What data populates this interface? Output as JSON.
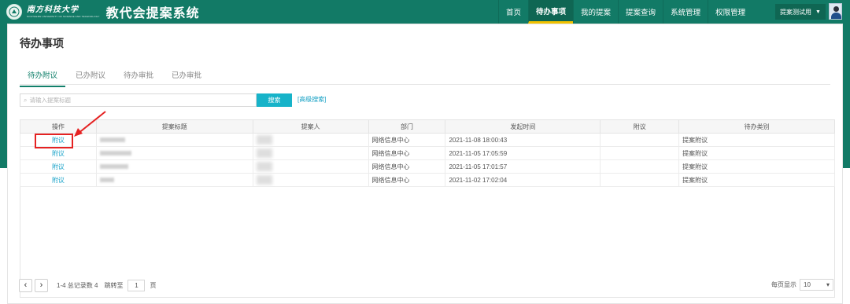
{
  "header": {
    "university_name": "南方科技大学",
    "university_en": "SOUTHERN UNIVERSITY OF SCIENCE AND TECHNOLOGY",
    "system_title": "教代会提案系统",
    "nav": [
      {
        "label": "首页",
        "active": false
      },
      {
        "label": "待办事项",
        "active": true
      },
      {
        "label": "我的提案",
        "active": false
      },
      {
        "label": "提案查询",
        "active": false
      },
      {
        "label": "系统管理",
        "active": false
      },
      {
        "label": "权限管理",
        "active": false
      }
    ],
    "user_label": "提案测试用"
  },
  "page": {
    "title": "待办事项",
    "tabs": [
      {
        "label": "待办附议",
        "active": true
      },
      {
        "label": "已办附议",
        "active": false
      },
      {
        "label": "待办审批",
        "active": false
      },
      {
        "label": "已办审批",
        "active": false
      }
    ]
  },
  "search": {
    "placeholder": "请输入提案标题",
    "button": "搜索",
    "advanced": "[高级搜索]"
  },
  "table": {
    "columns": [
      "操作",
      "提案标题",
      "提案人",
      "部门",
      "发起时间",
      "附议",
      "待办类别"
    ],
    "rows": [
      {
        "op": "附议",
        "dept": "网络信息中心",
        "time": "2021-11-08 18:00:43",
        "category": "提案附议"
      },
      {
        "op": "附议",
        "dept": "网络信息中心",
        "time": "2021-11-05 17:05:59",
        "category": "提案附议"
      },
      {
        "op": "附议",
        "dept": "网络信息中心",
        "time": "2021-11-05 17:01:57",
        "category": "提案附议"
      },
      {
        "op": "附议",
        "dept": "网络信息中心",
        "time": "2021-11-02 17:02:04",
        "category": "提案附议"
      }
    ]
  },
  "pager": {
    "summary": "1-4 总记录数 4",
    "jump_label": "跳转至",
    "page": "1",
    "page_unit": "页",
    "per_page_label": "每页显示",
    "per_page": "10"
  },
  "colors": {
    "brand": "#127a66",
    "accent": "#17b3c9",
    "link": "#1aa3c9",
    "highlight": "#e52222"
  }
}
